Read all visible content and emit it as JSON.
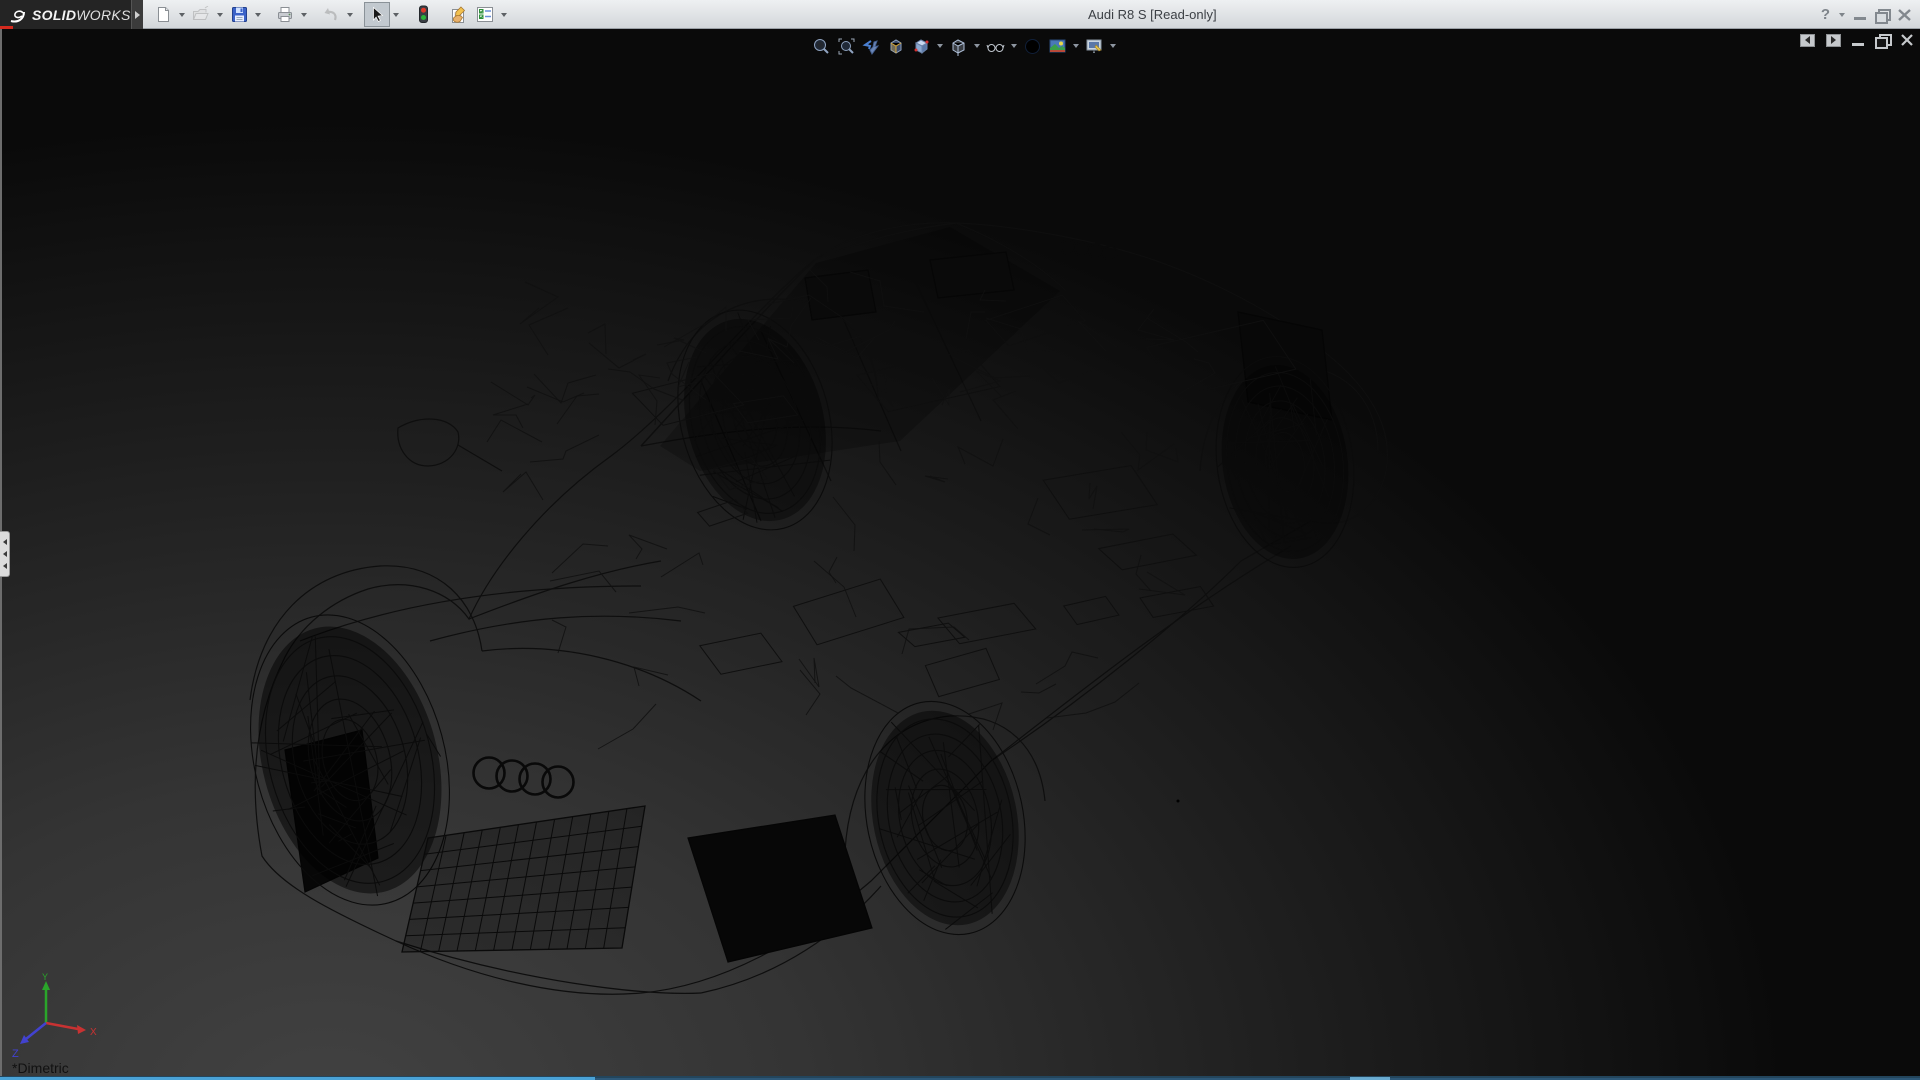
{
  "window": {
    "brand": {
      "logo_icon": "3ds-swoosh-icon",
      "name_bold": "SOLID",
      "name_light": "WORKS"
    },
    "title": "Audi R8 S [Read-only]",
    "help_glyph": "?"
  },
  "main_toolbar": {
    "icons": [
      "new-document",
      "open",
      "save",
      "print",
      "undo",
      "select-cursor",
      "rebuild-traffic-light",
      "file-properties",
      "options"
    ]
  },
  "headsup_toolbar": {
    "icons": [
      "zoom-to-fit",
      "zoom-to-area",
      "previous-view",
      "section-view",
      "view-orientation",
      "display-style",
      "hide-show-items",
      "edit-appearance",
      "apply-scene",
      "view-settings"
    ]
  },
  "document_controls": {
    "icons": [
      "feature-pane-left",
      "feature-pane-right",
      "minimize-document",
      "restore-document",
      "close-document"
    ]
  },
  "viewport": {
    "view_label": "*Dimetric",
    "triad": {
      "x_label": "X",
      "y_label": "Y",
      "z_label": "Z",
      "x_color": "#c83232",
      "y_color": "#2aa52a",
      "z_color": "#4242d0"
    }
  },
  "colors": {
    "accent_red": "#d42a1e",
    "taskbar_blue": "#4aa2d6"
  }
}
